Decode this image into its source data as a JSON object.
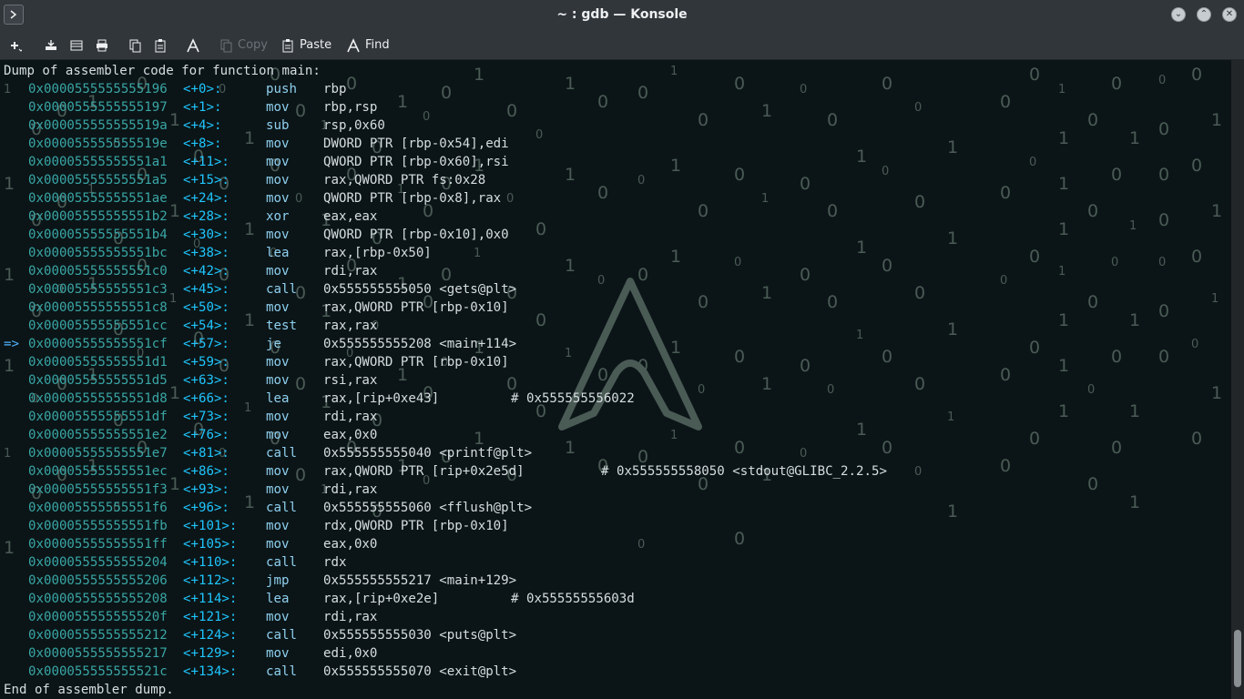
{
  "window": {
    "title": "~ : gdb — Konsole"
  },
  "toolbar": {
    "items": [
      {
        "icon": "new-tab-icon",
        "label": ""
      },
      {
        "icon": "split-view-icon",
        "label": ""
      },
      {
        "icon": "view-icon",
        "label": ""
      },
      {
        "icon": "print-icon",
        "label": ""
      },
      {
        "icon": "copy-icon",
        "label": ""
      },
      {
        "icon": "paste-icon",
        "label": ""
      },
      {
        "icon": "find-icon",
        "label": ""
      },
      {
        "icon": "copy-icon",
        "label": "Copy",
        "disabled": true
      },
      {
        "icon": "paste-icon",
        "label": "Paste"
      },
      {
        "icon": "find-icon",
        "label": "Find"
      }
    ]
  },
  "terminal": {
    "header": "Dump of assembler code for function main:",
    "footer": "End of assembler dump.",
    "current_marker": "=>",
    "instructions": [
      {
        "addr": "0x0000555555555196",
        "off": "<+0>:",
        "ins": "push",
        "ops": "rbp",
        "cmt": ""
      },
      {
        "addr": "0x0000555555555197",
        "off": "<+1>:",
        "ins": "mov",
        "ops": "rbp,rsp",
        "cmt": ""
      },
      {
        "addr": "0x000055555555519a",
        "off": "<+4>:",
        "ins": "sub",
        "ops": "rsp,0x60",
        "cmt": ""
      },
      {
        "addr": "0x000055555555519e",
        "off": "<+8>:",
        "ins": "mov",
        "ops": "DWORD PTR [rbp-0x54],edi",
        "cmt": ""
      },
      {
        "addr": "0x00005555555551a1",
        "off": "<+11>:",
        "ins": "mov",
        "ops": "QWORD PTR [rbp-0x60],rsi",
        "cmt": ""
      },
      {
        "addr": "0x00005555555551a5",
        "off": "<+15>:",
        "ins": "mov",
        "ops": "rax,QWORD PTR fs:0x28",
        "cmt": ""
      },
      {
        "addr": "0x00005555555551ae",
        "off": "<+24>:",
        "ins": "mov",
        "ops": "QWORD PTR [rbp-0x8],rax",
        "cmt": ""
      },
      {
        "addr": "0x00005555555551b2",
        "off": "<+28>:",
        "ins": "xor",
        "ops": "eax,eax",
        "cmt": ""
      },
      {
        "addr": "0x00005555555551b4",
        "off": "<+30>:",
        "ins": "mov",
        "ops": "QWORD PTR [rbp-0x10],0x0",
        "cmt": ""
      },
      {
        "addr": "0x00005555555551bc",
        "off": "<+38>:",
        "ins": "lea",
        "ops": "rax,[rbp-0x50]",
        "cmt": ""
      },
      {
        "addr": "0x00005555555551c0",
        "off": "<+42>:",
        "ins": "mov",
        "ops": "rdi,rax",
        "cmt": ""
      },
      {
        "addr": "0x00005555555551c3",
        "off": "<+45>:",
        "ins": "call",
        "ops": "0x555555555050 <gets@plt>",
        "cmt": ""
      },
      {
        "addr": "0x00005555555551c8",
        "off": "<+50>:",
        "ins": "mov",
        "ops": "rax,QWORD PTR [rbp-0x10]",
        "cmt": ""
      },
      {
        "addr": "0x00005555555551cc",
        "off": "<+54>:",
        "ins": "test",
        "ops": "rax,rax",
        "cmt": ""
      },
      {
        "addr": "0x00005555555551cf",
        "off": "<+57>:",
        "ins": "je",
        "ops": "0x555555555208 <main+114>",
        "cmt": "",
        "current": true
      },
      {
        "addr": "0x00005555555551d1",
        "off": "<+59>:",
        "ins": "mov",
        "ops": "rax,QWORD PTR [rbp-0x10]",
        "cmt": ""
      },
      {
        "addr": "0x00005555555551d5",
        "off": "<+63>:",
        "ins": "mov",
        "ops": "rsi,rax",
        "cmt": ""
      },
      {
        "addr": "0x00005555555551d8",
        "off": "<+66>:",
        "ins": "lea",
        "ops": "rax,[rip+0xe43]",
        "cmt": "# 0x555555556022"
      },
      {
        "addr": "0x00005555555551df",
        "off": "<+73>:",
        "ins": "mov",
        "ops": "rdi,rax",
        "cmt": ""
      },
      {
        "addr": "0x00005555555551e2",
        "off": "<+76>:",
        "ins": "mov",
        "ops": "eax,0x0",
        "cmt": ""
      },
      {
        "addr": "0x00005555555551e7",
        "off": "<+81>:",
        "ins": "call",
        "ops": "0x555555555040 <printf@plt>",
        "cmt": ""
      },
      {
        "addr": "0x00005555555551ec",
        "off": "<+86>:",
        "ins": "mov",
        "ops": "rax,QWORD PTR [rip+0x2e5d]",
        "cmt": "# 0x555555558050 <stdout@GLIBC_2.2.5>"
      },
      {
        "addr": "0x00005555555551f3",
        "off": "<+93>:",
        "ins": "mov",
        "ops": "rdi,rax",
        "cmt": ""
      },
      {
        "addr": "0x00005555555551f6",
        "off": "<+96>:",
        "ins": "call",
        "ops": "0x555555555060 <fflush@plt>",
        "cmt": ""
      },
      {
        "addr": "0x00005555555551fb",
        "off": "<+101>:",
        "ins": "mov",
        "ops": "rdx,QWORD PTR [rbp-0x10]",
        "cmt": ""
      },
      {
        "addr": "0x00005555555551ff",
        "off": "<+105>:",
        "ins": "mov",
        "ops": "eax,0x0",
        "cmt": ""
      },
      {
        "addr": "0x0000555555555204",
        "off": "<+110>:",
        "ins": "call",
        "ops": "rdx",
        "cmt": ""
      },
      {
        "addr": "0x0000555555555206",
        "off": "<+112>:",
        "ins": "jmp",
        "ops": "0x555555555217 <main+129>",
        "cmt": ""
      },
      {
        "addr": "0x0000555555555208",
        "off": "<+114>:",
        "ins": "lea",
        "ops": "rax,[rip+0xe2e]",
        "cmt": "# 0x55555555603d"
      },
      {
        "addr": "0x000055555555520f",
        "off": "<+121>:",
        "ins": "mov",
        "ops": "rdi,rax",
        "cmt": ""
      },
      {
        "addr": "0x0000555555555212",
        "off": "<+124>:",
        "ins": "call",
        "ops": "0x555555555030 <puts@plt>",
        "cmt": ""
      },
      {
        "addr": "0x0000555555555217",
        "off": "<+129>:",
        "ins": "mov",
        "ops": "edi,0x0",
        "cmt": ""
      },
      {
        "addr": "0x000055555555521c",
        "off": "<+134>:",
        "ins": "call",
        "ops": "0x555555555070 <exit@plt>",
        "cmt": ""
      }
    ]
  },
  "scrollbar": {
    "position": 0.98,
    "visible_fraction": 0.09
  },
  "colors": {
    "accent_current": "#4fb3ff",
    "address": "#3aa6a6",
    "offset": "#1fc6ff"
  }
}
